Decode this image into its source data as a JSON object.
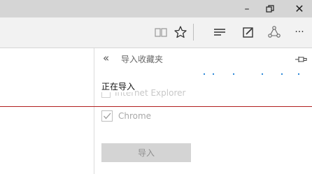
{
  "window": {
    "minimize_glyph": "–",
    "maximize_glyph": "🗗",
    "close_glyph": "✕"
  },
  "toolbar": {
    "icons": [
      "reading-view-icon",
      "favorite-star-icon",
      "hub-icon",
      "web-note-icon",
      "share-icon",
      "more-icon"
    ],
    "more_glyph": "···"
  },
  "panel": {
    "back_glyph": "«",
    "title": "导入收藏夹",
    "pin_icon": "pin-icon",
    "progress_text": "正在导入",
    "faded_option_text": "Internet Explorer",
    "options": [
      {
        "label": "Chrome",
        "checked": true
      }
    ],
    "import_button": "导入"
  },
  "colors": {
    "titlebar": "#d5d5d5",
    "toolbar": "#f2f2f2",
    "progress_dots": "#2b88d8",
    "red_line": "#b02020",
    "button_disabled": "#d4d4d4"
  }
}
